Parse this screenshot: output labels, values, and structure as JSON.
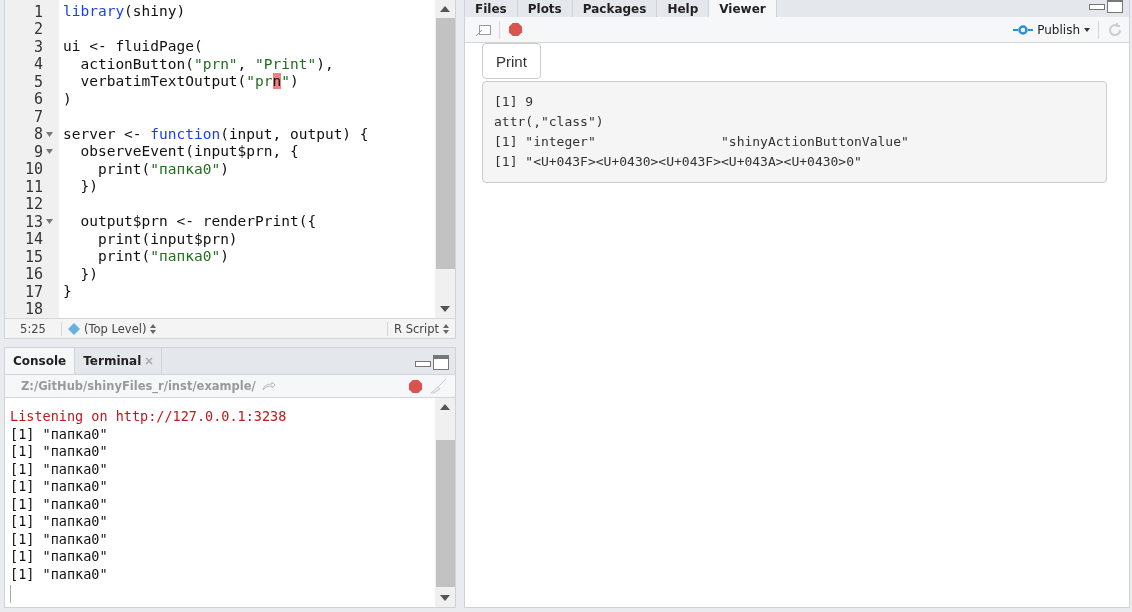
{
  "editor": {
    "lines": [
      {
        "number": "1",
        "fold": false,
        "tokens": [
          {
            "kind": "keyword",
            "text": "library"
          },
          {
            "kind": "plain",
            "text": "(shiny)"
          }
        ]
      },
      {
        "number": "2",
        "fold": false
      },
      {
        "number": "3",
        "fold": false,
        "tokens": [
          {
            "kind": "plain",
            "text": "ui <- fluidPage("
          }
        ]
      },
      {
        "number": "4",
        "fold": false,
        "tokens": [
          {
            "kind": "plain",
            "text": "  actionButton("
          },
          {
            "kind": "string",
            "text": "\"prn\""
          },
          {
            "kind": "plain",
            "text": ", "
          },
          {
            "kind": "string",
            "text": "\"Print\""
          },
          {
            "kind": "plain",
            "text": "),"
          }
        ]
      },
      {
        "number": "5",
        "fold": false,
        "tokens": [
          {
            "kind": "plain",
            "text": "  verbatimTextOutput("
          },
          {
            "kind": "string",
            "text": "\"pr"
          },
          {
            "kind": "cursor",
            "text": "n"
          },
          {
            "kind": "string",
            "text": "\""
          },
          {
            "kind": "plain",
            "text": ")"
          }
        ]
      },
      {
        "number": "6",
        "fold": false,
        "tokens": [
          {
            "kind": "plain",
            "text": ")"
          }
        ]
      },
      {
        "number": "7",
        "fold": false
      },
      {
        "number": "8",
        "fold": true,
        "tokens": [
          {
            "kind": "plain",
            "text": "server <- "
          },
          {
            "kind": "keyword",
            "text": "function"
          },
          {
            "kind": "plain",
            "text": "(input, output) {"
          }
        ]
      },
      {
        "number": "9",
        "fold": true,
        "tokens": [
          {
            "kind": "plain",
            "text": "  observeEvent(input$prn, {"
          }
        ]
      },
      {
        "number": "10",
        "fold": false,
        "tokens": [
          {
            "kind": "plain",
            "text": "    print("
          },
          {
            "kind": "string",
            "text": "\"папка0\""
          },
          {
            "kind": "plain",
            "text": ")"
          }
        ]
      },
      {
        "number": "11",
        "fold": false,
        "tokens": [
          {
            "kind": "plain",
            "text": "  })"
          }
        ]
      },
      {
        "number": "12",
        "fold": false
      },
      {
        "number": "13",
        "fold": true,
        "tokens": [
          {
            "kind": "plain",
            "text": "  output$prn <- renderPrint({"
          }
        ]
      },
      {
        "number": "14",
        "fold": false,
        "tokens": [
          {
            "kind": "plain",
            "text": "    print(input$prn)"
          }
        ]
      },
      {
        "number": "15",
        "fold": false,
        "tokens": [
          {
            "kind": "plain",
            "text": "    print("
          },
          {
            "kind": "string",
            "text": "\"папка0\""
          },
          {
            "kind": "plain",
            "text": ")"
          }
        ]
      },
      {
        "number": "16",
        "fold": false,
        "tokens": [
          {
            "kind": "plain",
            "text": "  })"
          }
        ]
      },
      {
        "number": "17",
        "fold": false,
        "tokens": [
          {
            "kind": "plain",
            "text": "}"
          }
        ]
      },
      {
        "number": "18",
        "fold": false
      }
    ],
    "status_bar": {
      "position": "5:25",
      "scope": "(Top Level)",
      "file_type": "R Script"
    }
  },
  "console_pane": {
    "tabs": [
      {
        "label": "Console",
        "selected": true,
        "closable": false
      },
      {
        "label": "Terminal",
        "selected": false,
        "closable": true
      }
    ],
    "path": "Z:/GitHub/shinyFiles_r/inst/example/",
    "lines": [
      {
        "kind": "message",
        "text": "Listening on http://127.0.0.1:3238"
      },
      {
        "kind": "output",
        "text": "[1] \"папка0\""
      },
      {
        "kind": "output",
        "text": "[1] \"папка0\""
      },
      {
        "kind": "output",
        "text": "[1] \"папка0\""
      },
      {
        "kind": "output",
        "text": "[1] \"папка0\""
      },
      {
        "kind": "output",
        "text": "[1] \"папка0\""
      },
      {
        "kind": "output",
        "text": "[1] \"папка0\""
      },
      {
        "kind": "output",
        "text": "[1] \"папка0\""
      },
      {
        "kind": "output",
        "text": "[1] \"папка0\""
      },
      {
        "kind": "output",
        "text": "[1] \"папка0\""
      }
    ]
  },
  "viewer_pane": {
    "tabs": [
      {
        "label": "Files",
        "selected": false
      },
      {
        "label": "Plots",
        "selected": false
      },
      {
        "label": "Packages",
        "selected": false
      },
      {
        "label": "Help",
        "selected": false
      },
      {
        "label": "Viewer",
        "selected": true
      }
    ],
    "publish_label": "Publish",
    "app": {
      "button_label": "Print",
      "output_lines": [
        "[1] 9",
        "attr(,\"class\")",
        "[1] \"integer\"                \"shinyActionButtonValue\"",
        "[1] \"<U+043F><U+0430><U+043F><U+043A><U+0430>0\""
      ]
    }
  }
}
